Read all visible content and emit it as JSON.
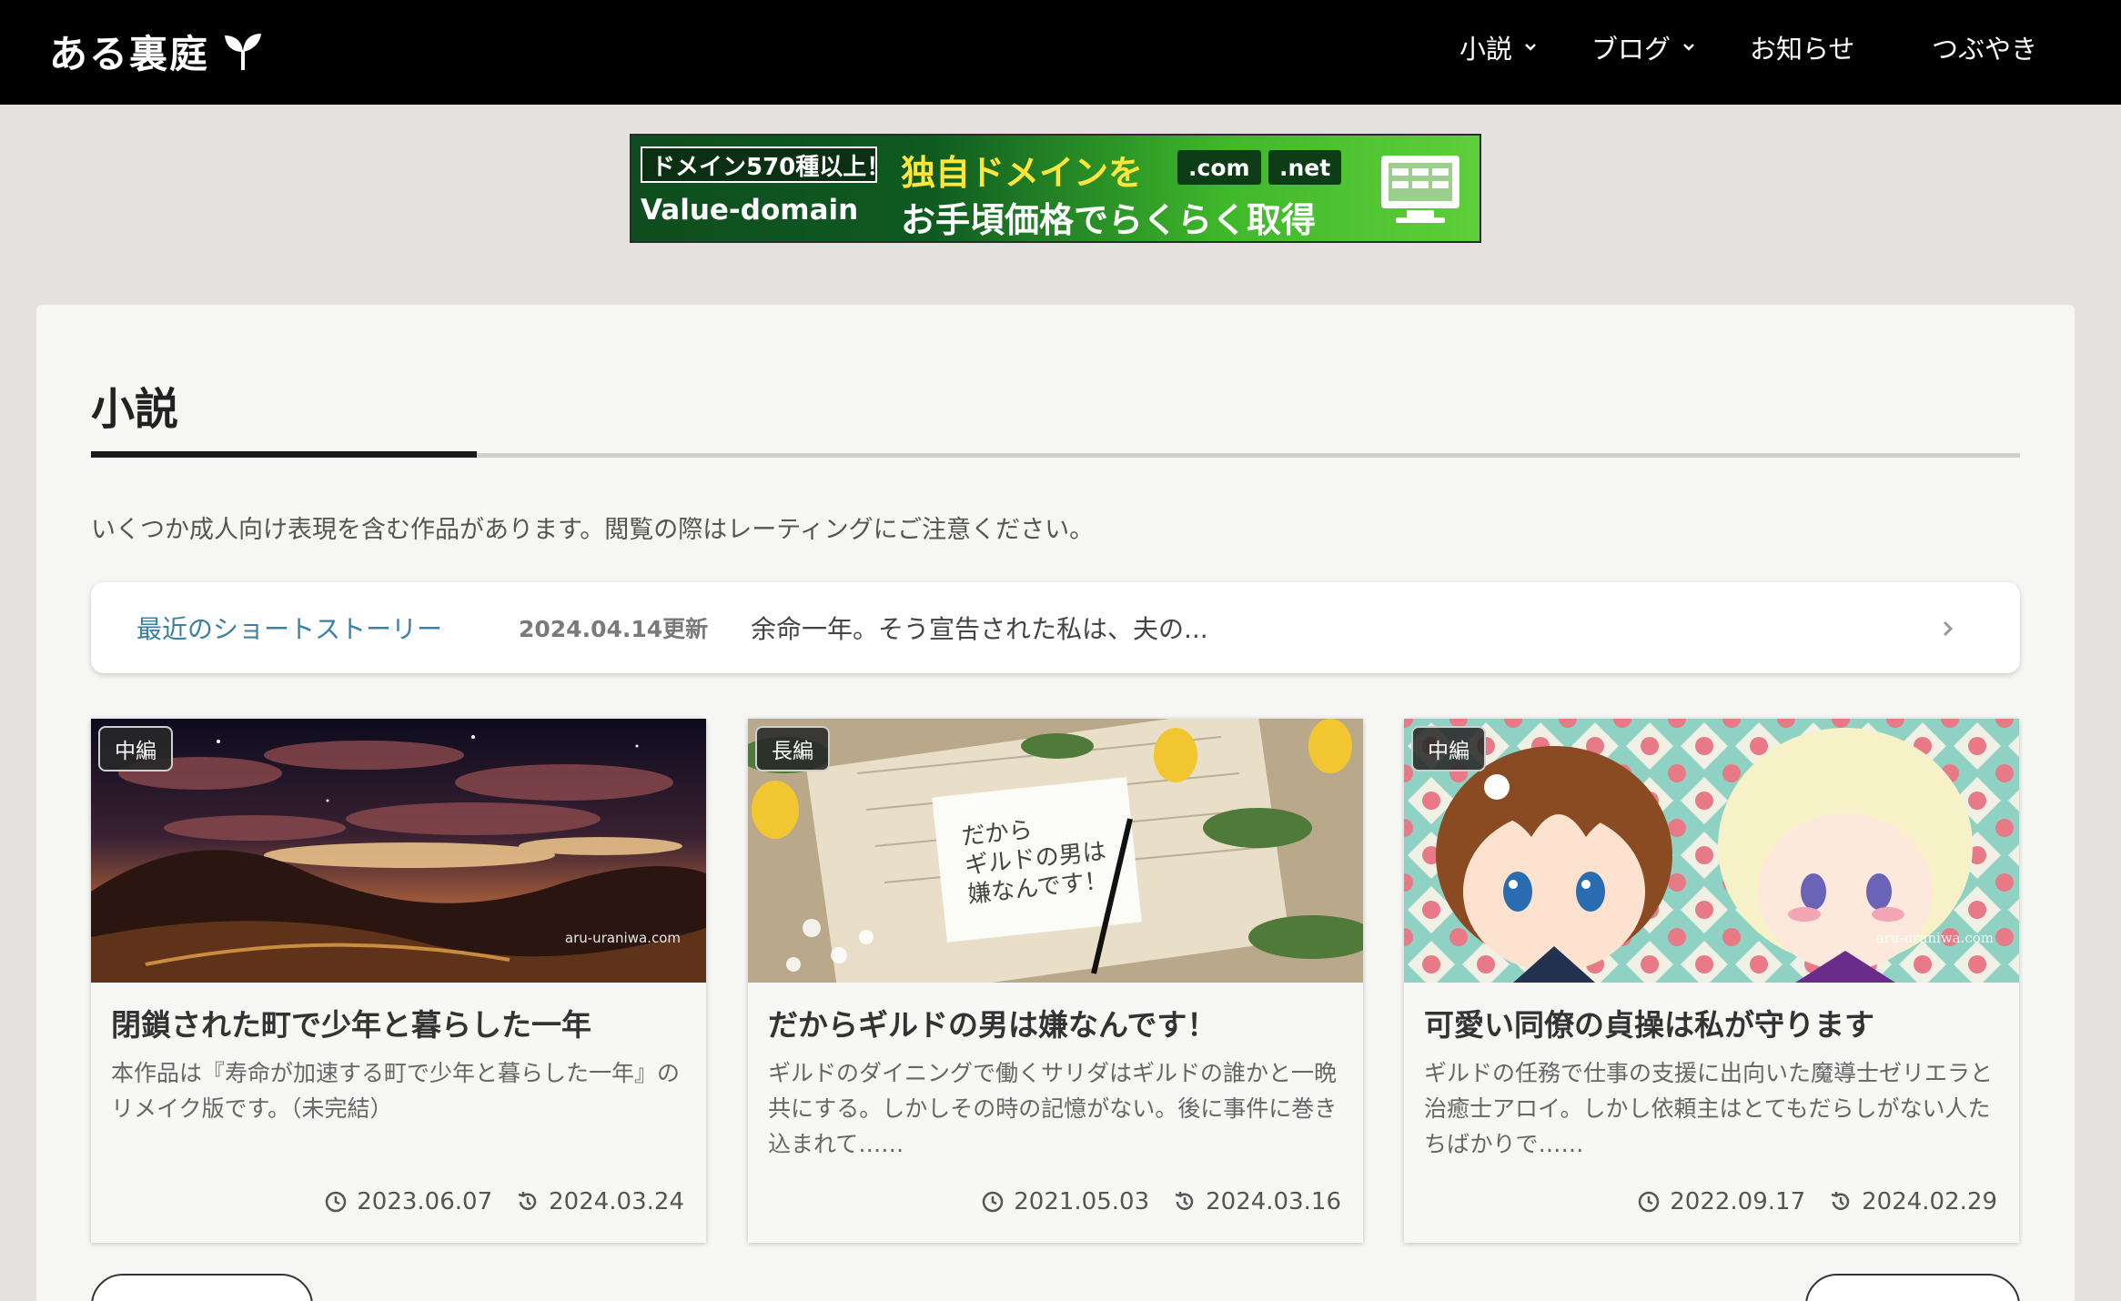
{
  "header": {
    "logo_text": "ある裏庭",
    "nav": [
      {
        "label": "小説",
        "has_dropdown": true
      },
      {
        "label": "ブログ",
        "has_dropdown": true
      },
      {
        "label": "お知らせ",
        "has_dropdown": false
      },
      {
        "label": "つぶやき",
        "has_dropdown": false
      }
    ]
  },
  "banner": {
    "tag": "ドメイン570種以上！",
    "brand": "Value-domain",
    "line1": "独自ドメインを",
    "tld1": ".com",
    "tld2": ".net",
    "line2": "お手頃価格でらくらく取得",
    "colors": {
      "accent": "#ffe63a",
      "bg": "#3fb82a"
    }
  },
  "section": {
    "title": "小説",
    "notice": "いくつか成人向け表現を含む作品があります。閲覧の際はレーティングにご注意ください。"
  },
  "short_story": {
    "label": "最近のショートストーリー",
    "date": "2024.04.14更新",
    "excerpt": "余命一年。そう宣告された私は、夫の..."
  },
  "cards": [
    {
      "badge": "中編",
      "title": "閉鎖された町で少年と暮らした一年",
      "desc": "本作品は『寿命が加速する町で少年と暮らした一年』のリメイク版です。（未完結）",
      "published": "2023.06.07",
      "updated": "2024.03.24",
      "watermark": "aru-uraniwa.com"
    },
    {
      "badge": "長編",
      "title": "だからギルドの男は嫌なんです！",
      "desc": "ギルドのダイニングで働くサリダはギルドの誰かと一晩共にする。しかしその時の記憶がない。後に事件に巻き込まれて……",
      "published": "2021.05.03",
      "updated": "2024.03.16",
      "card_text": "だから ギルドの男は 嫌なんです！"
    },
    {
      "badge": "中編",
      "title": "可愛い同僚の貞操は私が守ります",
      "desc": "ギルドの任務で仕事の支援に出向いた魔導士ゼリエラと治癒士アロイ。しかし依頼主はとてもだらしがない人たちばかりで……",
      "published": "2022.09.17",
      "updated": "2024.02.29",
      "watermark": "aru-uraniwa.com"
    }
  ]
}
